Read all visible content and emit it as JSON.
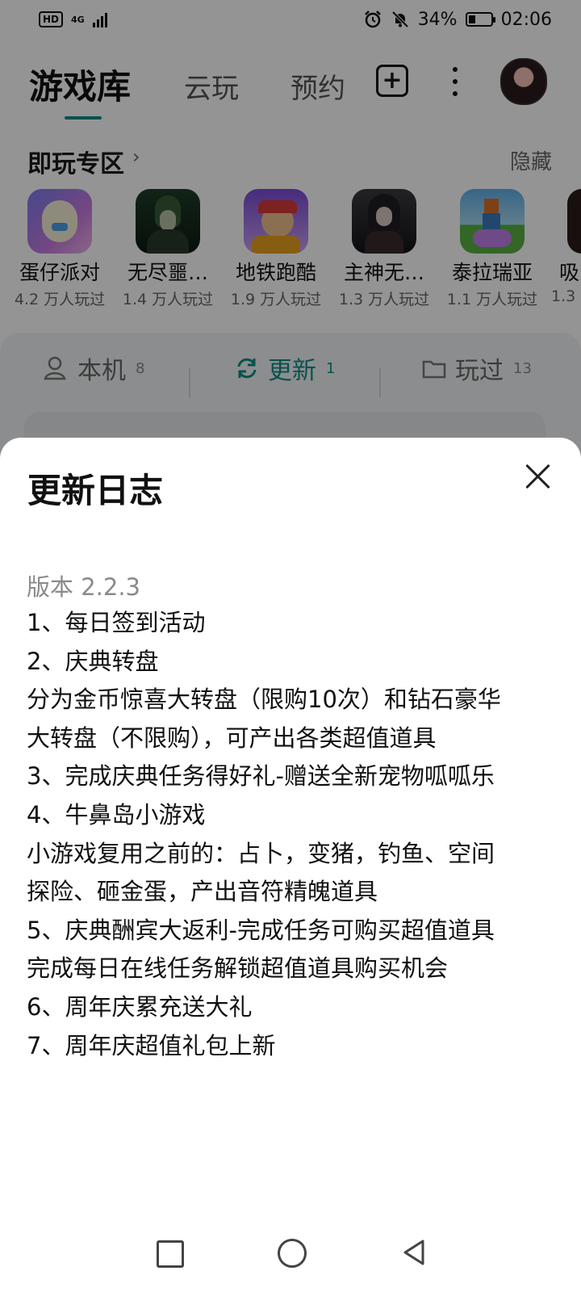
{
  "status_bar": {
    "hd": "HD",
    "network": "4G",
    "battery_percent": "34%",
    "battery_level": 0.34,
    "time": "02:06"
  },
  "header": {
    "tabs": [
      {
        "label": "游戏库",
        "active": true
      },
      {
        "label": "云玩",
        "active": false
      },
      {
        "label": "预约",
        "active": false
      }
    ],
    "accent_color": "#0a8e86"
  },
  "instant_play": {
    "title": "即玩专区",
    "chevron": "›",
    "hide_label": "隐藏",
    "games": [
      {
        "name": "蛋仔派对",
        "plays": "4.2 万人玩过",
        "icon": "eggy-party-icon"
      },
      {
        "name": "无尽噩…",
        "plays": "1.4 万人玩过",
        "icon": "endless-nightmare-icon"
      },
      {
        "name": "地铁跑酷",
        "plays": "1.9 万人玩过",
        "icon": "subway-surfers-icon"
      },
      {
        "name": "主神无…",
        "plays": "1.3 万人玩过",
        "icon": "main-god-icon"
      },
      {
        "name": "泰拉瑞亚",
        "plays": "1.1 万人玩过",
        "icon": "terraria-icon"
      },
      {
        "name": "吸",
        "plays": "1.3",
        "icon": "partial-game-icon"
      }
    ]
  },
  "filter_tabs": [
    {
      "label": "本机",
      "count": "8",
      "icon": "phone-user-icon"
    },
    {
      "label": "更新",
      "count": "1",
      "icon": "refresh-icon",
      "active": true
    },
    {
      "label": "玩过",
      "count": "13",
      "icon": "folder-icon"
    }
  ],
  "changelog": {
    "title": "更新日志",
    "version": "版本 2.2.3",
    "lines": [
      "1、每日签到活动",
      "2、庆典转盘",
      "分为金币惊喜大转盘（限购10次）和钻石豪华",
      "大转盘（不限购），可产出各类超值道具",
      "3、完成庆典任务得好礼-赠送全新宠物呱呱乐",
      "4、牛鼻岛小游戏",
      "小游戏复用之前的：占卜，变猪，钓鱼、空间",
      "探险、砸金蛋，产出音符精魄道具",
      "5、庆典酬宾大返利-完成任务可购买超值道具",
      "完成每日在线任务解锁超值道具购买机会",
      "6、周年庆累充送大礼",
      "7、周年庆超值礼包上新"
    ]
  }
}
